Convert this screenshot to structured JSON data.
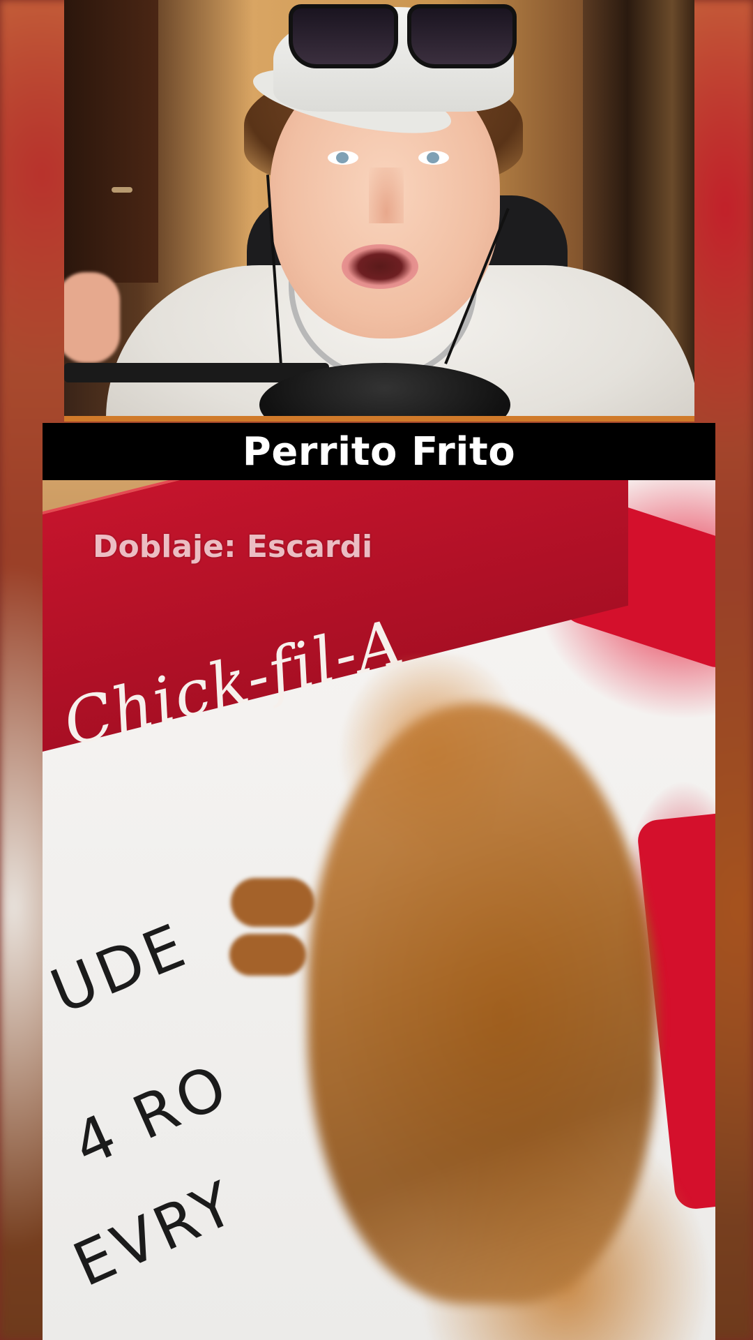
{
  "title": "Perrito Frito",
  "watermark": "Doblaje: Escardi",
  "box_brand": "Chick-fil-A",
  "handwriting": {
    "line1": "UDE",
    "line2": "4 RO",
    "line3": "EVRY"
  },
  "colors": {
    "title_bar_bg": "#000000",
    "title_text": "#ffffff",
    "box_red": "#c4142c",
    "cam_underline": "#d07a2a"
  }
}
